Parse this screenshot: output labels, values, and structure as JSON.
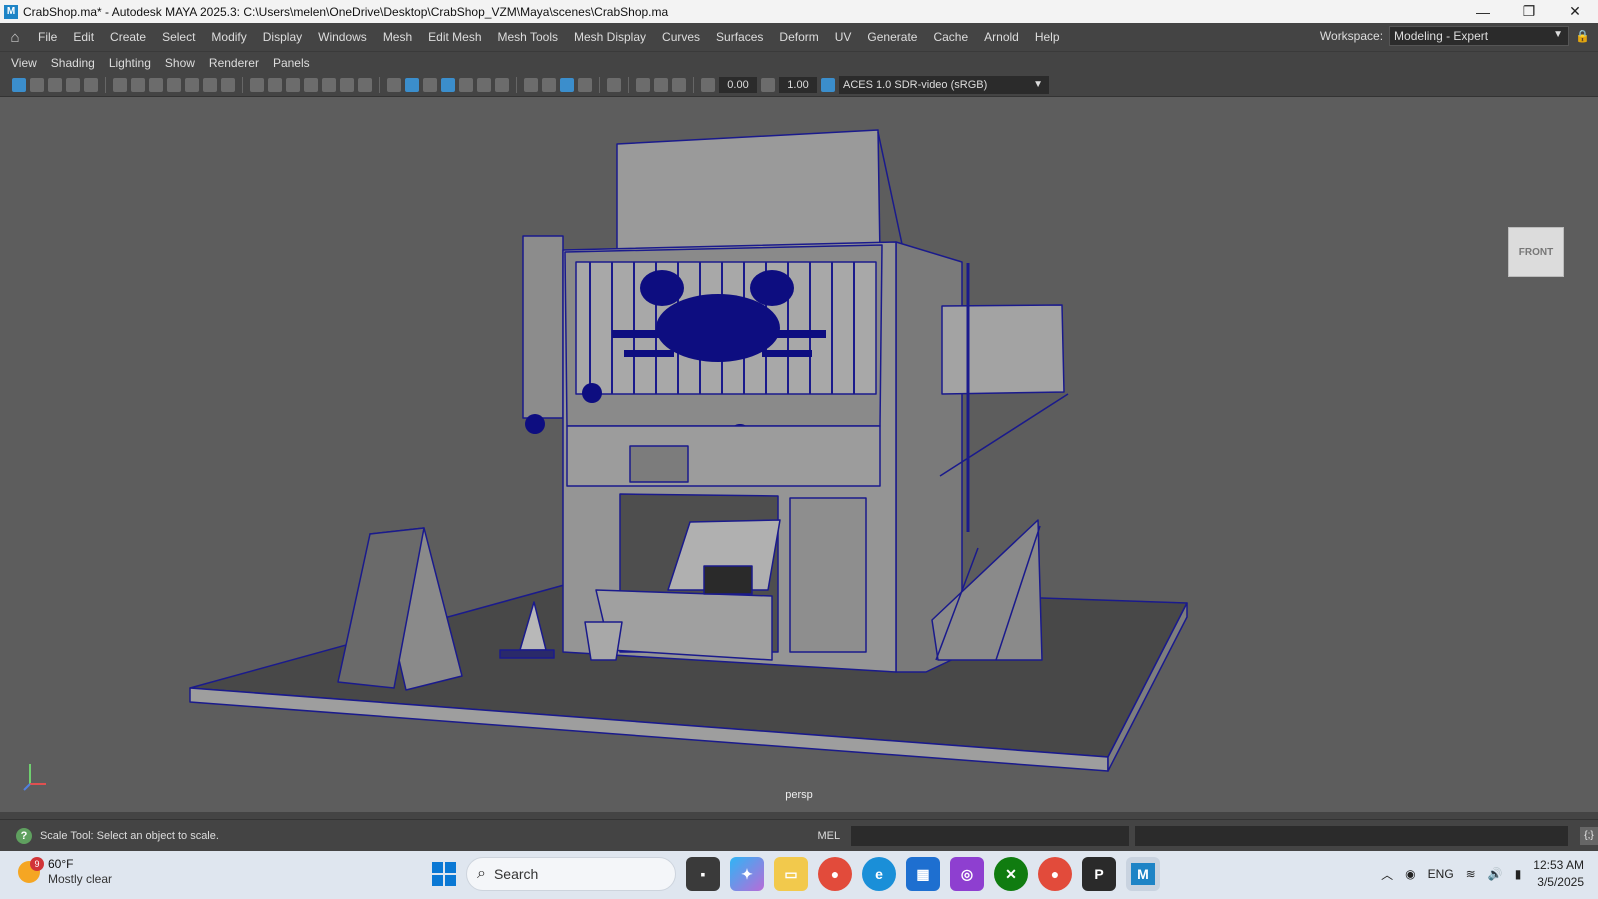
{
  "titlebar": {
    "app_icon": "maya-icon",
    "title": "CrabShop.ma* - Autodesk MAYA 2025.3: C:\\Users\\melen\\OneDrive\\Desktop\\CrabShop_VZM\\Maya\\scenes\\CrabShop.ma",
    "minimize": "—",
    "maximize": "❐",
    "close": "✕"
  },
  "menubar": {
    "items": [
      "File",
      "Edit",
      "Create",
      "Select",
      "Modify",
      "Display",
      "Windows",
      "Mesh",
      "Edit Mesh",
      "Mesh Tools",
      "Mesh Display",
      "Curves",
      "Surfaces",
      "Deform",
      "UV",
      "Generate",
      "Cache",
      "Arnold",
      "Help"
    ],
    "workspace_label": "Workspace:",
    "workspace_value": "Modeling - Expert"
  },
  "panel_menu": {
    "items": [
      "View",
      "Shading",
      "Lighting",
      "Show",
      "Renderer",
      "Panels"
    ]
  },
  "toolbar": {
    "exposure": "0.00",
    "gamma": "1.00",
    "color_space": "ACES 1.0 SDR-video (sRGB)"
  },
  "viewport": {
    "camera": "persp",
    "viewcube_label": "FRONT",
    "colors": {
      "background": "#5d5d5d",
      "wire": "#1a1a8c",
      "mesh": "#9a9a9a",
      "ground": "#484848"
    }
  },
  "statusbar": {
    "help_text": "Scale Tool: Select an object to scale.",
    "mel_label": "MEL"
  },
  "taskbar": {
    "weather_badge": "9",
    "temperature": "60°F",
    "condition": "Mostly clear",
    "search_placeholder": "Search",
    "language": "ENG",
    "time": "12:53 AM",
    "date": "3/5/2025"
  }
}
